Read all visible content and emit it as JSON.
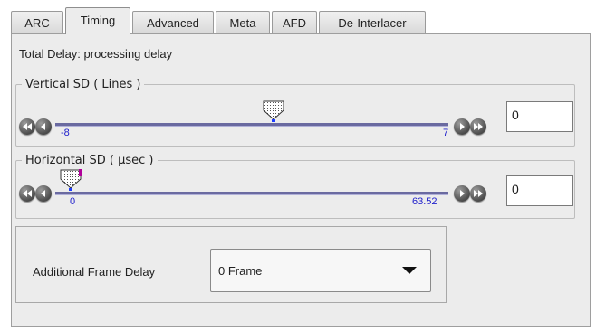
{
  "tabs": [
    {
      "label": "ARC",
      "active": false
    },
    {
      "label": "Timing",
      "active": true
    },
    {
      "label": "Advanced",
      "active": false
    },
    {
      "label": "Meta",
      "active": false
    },
    {
      "label": "AFD",
      "active": false
    },
    {
      "label": "De-Interlacer",
      "active": false
    }
  ],
  "total_delay_label": "Total Delay: processing delay",
  "vertical": {
    "legend": "Vertical SD ( Lines )",
    "min_label": "-8",
    "max_label": "7",
    "value": "0",
    "slider_value": 0
  },
  "horizontal": {
    "legend": "Horizontal SD ( µsec )",
    "min_label": "0",
    "max_label": "63.52",
    "value": "0",
    "slider_value": 0
  },
  "frame_delay": {
    "label": "Additional Frame Delay",
    "selected": "0 Frame"
  },
  "colors": {
    "tick_label": "#2020cc",
    "track": "#6a6aa0"
  }
}
